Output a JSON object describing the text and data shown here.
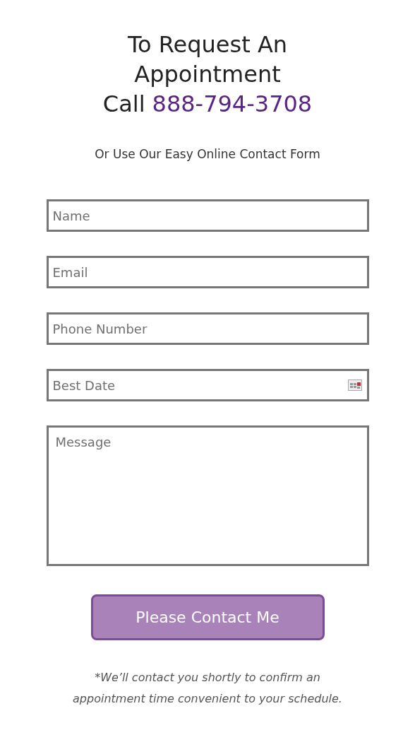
{
  "heading": {
    "lines": [
      "To Request An",
      "Appointment"
    ],
    "call_prefix": "Call",
    "phone": "888-794-3708"
  },
  "subtitle": "Or Use Our Easy Online Contact Form",
  "fields": [
    {
      "kind": "text",
      "placeholder": "Name"
    },
    {
      "kind": "text",
      "placeholder": "Email"
    },
    {
      "kind": "text",
      "placeholder": "Phone Number"
    },
    {
      "kind": "date",
      "placeholder": "Best Date"
    },
    {
      "kind": "textarea",
      "placeholder": "Message"
    }
  ],
  "submit_button": "Please Contact Me",
  "note": "*We’ll contact you shortly to confirm an appointment time convenient to your schedule."
}
